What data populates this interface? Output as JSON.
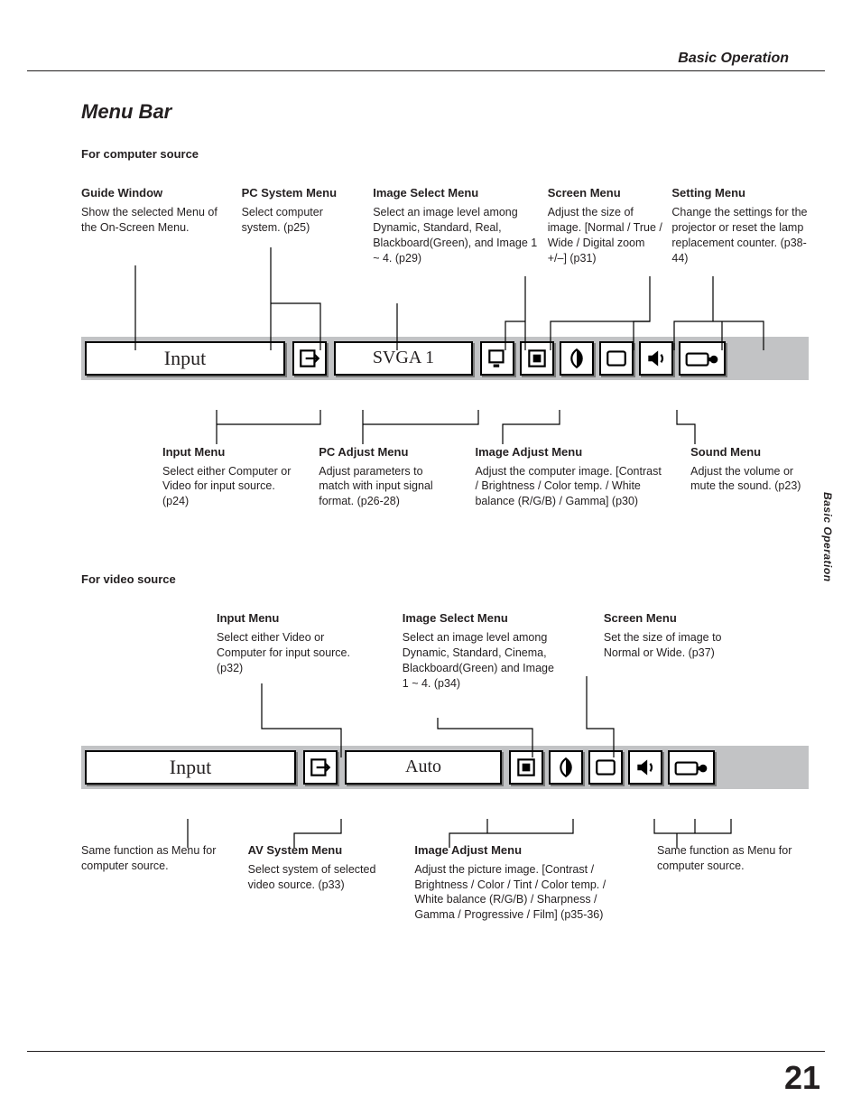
{
  "doc": {
    "running_head": "Basic Operation",
    "side_tab": "Basic Operation",
    "title": "Menu Bar",
    "page_number": "21"
  },
  "sec1": {
    "label": "For computer source",
    "top": {
      "guide_window": {
        "h": "Guide Window",
        "p": "Show the selected Menu of the On-Screen Menu."
      },
      "pc_system": {
        "h": "PC System Menu",
        "p": "Select computer system. (p25)"
      },
      "image_select": {
        "h": "Image Select Menu",
        "p": "Select  an image level among Dynamic, Standard, Real, Blackboard(Green), and Image 1 ~ 4. (p29)"
      },
      "screen": {
        "h": "Screen Menu",
        "p": "Adjust the size of image.  [Normal / True / Wide / Digital zoom +/–] (p31)"
      },
      "setting": {
        "h": "Setting Menu",
        "p": "Change the settings for the projector or reset the lamp replacement counter. (p38-44)"
      }
    },
    "bar": {
      "guide_label": "Input",
      "system_label": "SVGA 1"
    },
    "bottom": {
      "input": {
        "h": "Input Menu",
        "p": "Select either Computer or Video for input source. (p24)"
      },
      "pc_adjust": {
        "h": "PC Adjust Menu",
        "p": "Adjust parameters to match with input signal format. (p26-28)"
      },
      "image_adjust": {
        "h": "Image Adjust Menu",
        "p": "Adjust the computer image. [Contrast / Brightness / Color temp. /  White balance (R/G/B) / Gamma] (p30)"
      },
      "sound": {
        "h": "Sound Menu",
        "p": "Adjust the volume or mute the sound. (p23)"
      }
    }
  },
  "sec2": {
    "label": "For video source",
    "top": {
      "input": {
        "h": "Input Menu",
        "p": "Select either Video or Computer for input source. (p32)"
      },
      "image_select": {
        "h": "Image Select Menu",
        "p": "Select an image level among Dynamic, Standard, Cinema, Blackboard(Green) and Image 1 ~ 4. (p34)"
      },
      "screen": {
        "h": "Screen Menu",
        "p": "Set the size of image to Normal or Wide. (p37)"
      }
    },
    "bar": {
      "guide_label": "Input",
      "system_label": "Auto"
    },
    "bottom": {
      "same_note_left": "Same function as Menu for computer source.",
      "av_system": {
        "h": "AV System Menu",
        "p": "Select system of selected video source. (p33)"
      },
      "image_adjust": {
        "h": "Image Adjust Menu",
        "p": "Adjust the picture image. [Contrast / Brightness / Color / Tint / Color temp. / White balance (R/G/B) / Sharpness / Gamma / Progressive / Film] (p35-36)"
      },
      "same_note_right": "Same function as Menu for computer source."
    }
  }
}
